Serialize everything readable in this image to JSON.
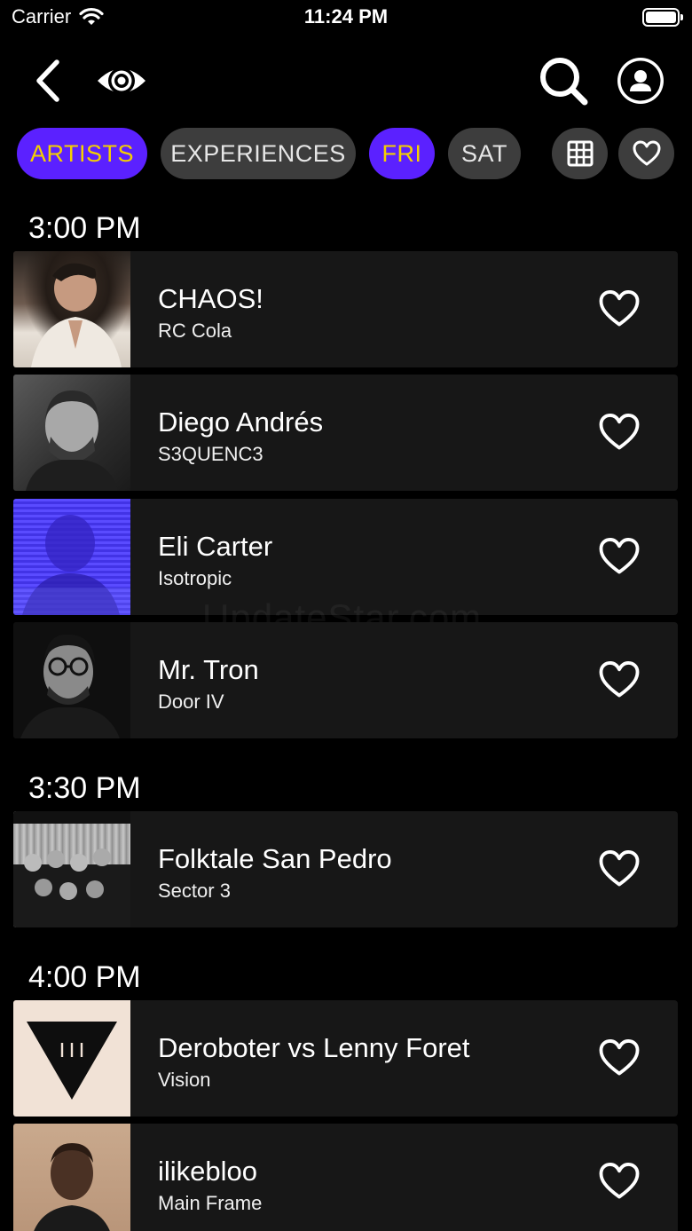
{
  "status_bar": {
    "carrier": "Carrier",
    "time": "11:24 PM"
  },
  "nav": {
    "back_icon": "chevron-left-icon",
    "logo_icon": "target-logo-icon",
    "search_icon": "search-icon",
    "profile_icon": "user-icon"
  },
  "filters": {
    "artists": "ARTISTS",
    "experiences": "EXPERIENCES",
    "fri": "FRI",
    "sat": "SAT",
    "active": [
      "ARTISTS",
      "FRI"
    ],
    "grid_icon": "grid-icon",
    "favorites_icon": "heart-icon",
    "active_bg": "#5b21ff",
    "active_text": "#f5d000",
    "inactive_bg": "#3d3d3d"
  },
  "schedule": [
    {
      "time": "3:00 PM",
      "artists": [
        {
          "name": "CHAOS!",
          "stage": "RC Cola"
        },
        {
          "name": "Diego Andrés",
          "stage": "S3QUENC3"
        },
        {
          "name": "Eli Carter",
          "stage": "Isotropic"
        },
        {
          "name": "Mr. Tron",
          "stage": "Door IV"
        }
      ]
    },
    {
      "time": "3:30 PM",
      "artists": [
        {
          "name": "Folktale San Pedro",
          "stage": "Sector 3"
        }
      ]
    },
    {
      "time": "4:00 PM",
      "artists": [
        {
          "name": "Deroboter vs Lenny Foret",
          "stage": "Vision"
        },
        {
          "name": "ilikebloo",
          "stage": "Main Frame"
        }
      ]
    }
  ],
  "watermark": "UpdateStar.com"
}
